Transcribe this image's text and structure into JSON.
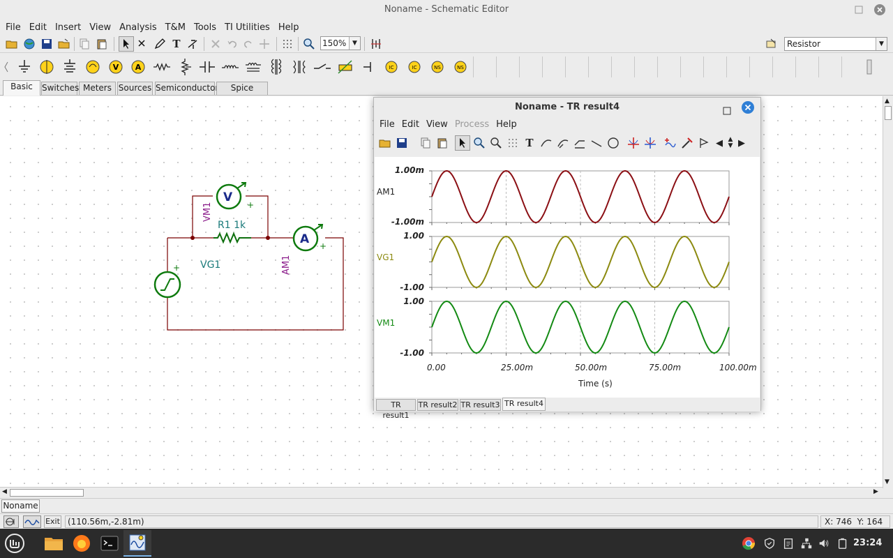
{
  "window": {
    "title": "Noname - Schematic Editor"
  },
  "menu": [
    "File",
    "Edit",
    "Insert",
    "View",
    "Analysis",
    "T&M",
    "Tools",
    "TI Utilities",
    "Help"
  ],
  "toolbar": {
    "zoom": "150%",
    "component": "Resistor"
  },
  "parts_tabs": [
    "Basic",
    "Switches",
    "Meters",
    "Sources",
    "Semiconductors",
    "Spice Macros"
  ],
  "schematic": {
    "vm_label": "VM1",
    "resistor_label": "R1 1k",
    "am_label": "AM1",
    "vg_label": "VG1",
    "voltmeter_glyph": "V",
    "ammeter_glyph": "A"
  },
  "results_window": {
    "title": "Noname - TR result4",
    "menu": [
      "File",
      "Edit",
      "View",
      "Process",
      "Help"
    ],
    "plots": [
      {
        "name": "AM1",
        "ymax": "1.00m",
        "ymin": "-1.00m",
        "color": "#8b0f14"
      },
      {
        "name": "VG1",
        "ymax": "1.00",
        "ymin": "-1.00",
        "color": "#8c8a10"
      },
      {
        "name": "VM1",
        "ymax": "1.00",
        "ymin": "-1.00",
        "color": "#138a13"
      }
    ],
    "x_ticks": [
      "0.00",
      "25.00m",
      "50.00m",
      "75.00m",
      "100.00m"
    ],
    "x_label": "Time (s)",
    "tabs": [
      "TR result1",
      "TR result2",
      "TR result3",
      "TR result4"
    ]
  },
  "chart_data": {
    "type": "line",
    "x": [
      0,
      0.0025,
      0.005,
      0.0075,
      0.01,
      0.0125,
      0.015,
      0.0175,
      0.02,
      0.0225,
      0.025,
      0.0275,
      0.03,
      0.0325,
      0.035,
      0.0375,
      0.04,
      0.0425,
      0.045,
      0.0475,
      0.05,
      0.0525,
      0.055,
      0.0575,
      0.06,
      0.0625,
      0.065,
      0.0675,
      0.07,
      0.0725,
      0.075,
      0.0775,
      0.08,
      0.0825,
      0.085,
      0.0875,
      0.09,
      0.0925,
      0.095,
      0.0975,
      0.1
    ],
    "series": [
      {
        "name": "AM1",
        "amplitude": 0.001,
        "frequency_hz": 50,
        "phase_deg": 0
      },
      {
        "name": "VG1",
        "amplitude": 1.0,
        "frequency_hz": 50,
        "phase_deg": 0
      },
      {
        "name": "VM1",
        "amplitude": 1.0,
        "frequency_hz": 50,
        "phase_deg": 0
      }
    ],
    "xlabel": "Time (s)",
    "xlim": [
      0,
      0.1
    ],
    "grid": true
  },
  "document_tab": "Noname",
  "status": {
    "cursor_value": "(110.56m,-2.81m)",
    "coords": "X: 746  Y: 164",
    "exit_label": "Exit"
  },
  "taskbar": {
    "clock": "23:24"
  }
}
